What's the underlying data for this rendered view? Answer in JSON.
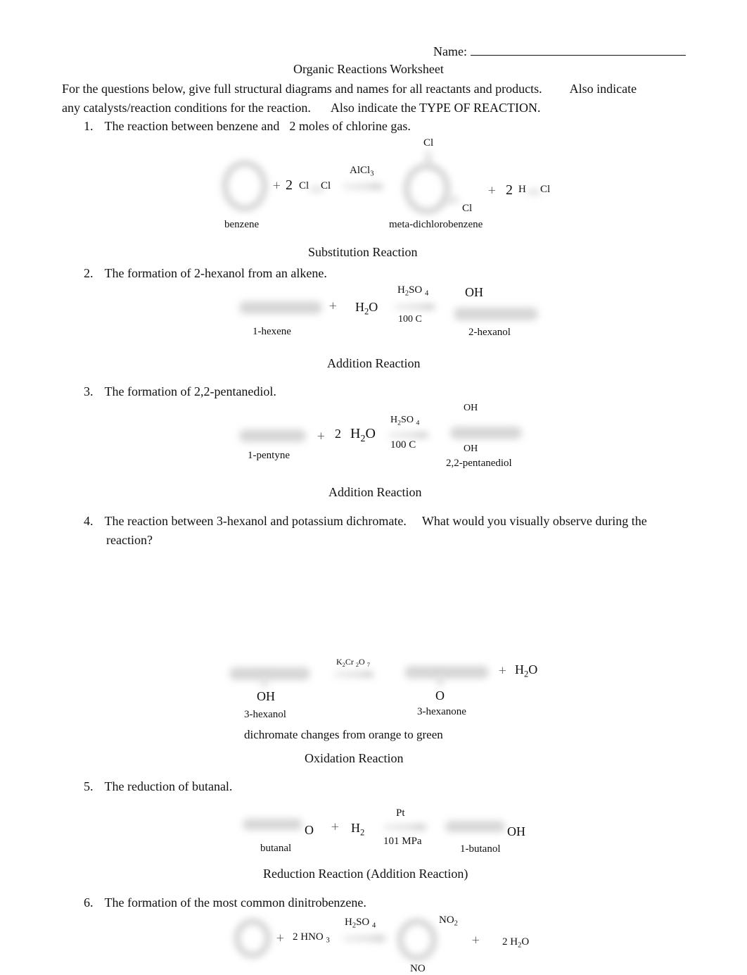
{
  "header": {
    "name_label": "Name:",
    "title": "Organic Reactions Worksheet"
  },
  "instructions": {
    "line1a": "For the questions below, give full structural diagrams and names for all reactants and products.",
    "line1b": "Also indicate",
    "line2a": "any catalysts/reaction conditions for the reaction.",
    "line2b": "Also indicate the TYPE OF REACTION."
  },
  "questions": [
    {
      "number": "1.",
      "text_a": "The reaction between benzene and",
      "text_b": "2 moles",
      "text_c": "of chlorine gas.",
      "reactant1_name": "benzene",
      "coef1": "2",
      "cl_a": "Cl",
      "cl_b": "Cl",
      "catalyst": "AlCl",
      "catalyst_sub": "3",
      "product_cl_top": "Cl",
      "product_cl_bottom": "Cl",
      "product_name": "meta-dichlorobenzene",
      "coef2": "2",
      "h": "H",
      "hcl_cl": "Cl",
      "plus": "+",
      "reaction_type": "Substitution Reaction"
    },
    {
      "number": "2.",
      "text": "The formation of 2-hexanol from an alkene.",
      "reactant_name": "1-hexene",
      "water_h": "H",
      "water_sub": "2",
      "water_o": "O",
      "catalyst_h": "H",
      "catalyst_sub1": "2",
      "catalyst_so": "SO",
      "catalyst_sub2": "4",
      "condition": "100 C",
      "product_oh": "OH",
      "product_name": "2-hexanol",
      "plus": "+",
      "reaction_type": "Addition Reaction"
    },
    {
      "number": "3.",
      "text": "The formation of 2,2-pentanediol.",
      "reactant_name": "1-pentyne",
      "coef": "2",
      "water_h": "H",
      "water_sub": "2",
      "water_o": "O",
      "catalyst_h": "H",
      "catalyst_sub1": "2",
      "catalyst_so": "SO",
      "catalyst_sub2": "4",
      "condition": "100 C",
      "product_oh_top": "OH",
      "product_oh_bottom": "OH",
      "product_name": "2,2-pentanediol",
      "plus": "+",
      "reaction_type": "Addition Reaction"
    },
    {
      "number": "4.",
      "text_line1": "The reaction between 3-hexanol and potassium dichromate.",
      "text_line1b": "What would you visually observe during the",
      "text_line2": "reaction?",
      "reactant_oh": "OH",
      "reactant_name": "3-hexanol",
      "catalyst_k": "K",
      "catalyst_sub1": "2",
      "catalyst_cr": "Cr",
      "catalyst_sub2": "2",
      "catalyst_o": "O",
      "catalyst_sub3": "7",
      "product_o": "O",
      "product_name": "3-hexanone",
      "water_h": "H",
      "water_sub": "2",
      "water_o": "O",
      "observation": "dichromate changes from orange to green",
      "plus": "+",
      "reaction_type": "Oxidation Reaction"
    },
    {
      "number": "5.",
      "text": "The reduction of butanal.",
      "reactant_o": "O",
      "reactant_name": "butanal",
      "h2_h": "H",
      "h2_sub": "2",
      "catalyst": "Pt",
      "condition": "101 MPa",
      "product_oh": "OH",
      "product_name": "1-butanol",
      "plus": "+",
      "reaction_type": "Reduction Reaction (Addition Reaction)"
    },
    {
      "number": "6.",
      "text": "The formation of the most common dinitrobenzene.",
      "reagent": "2 HNO",
      "reagent_sub": "3",
      "catalyst_h": "H",
      "catalyst_sub1": "2",
      "catalyst_so": "SO",
      "catalyst_sub2": "4",
      "product_no2_top": "NO",
      "product_no2_top_sub": "2",
      "product_no2_bottom": "NO",
      "water_coef": "2 H",
      "water_sub": "2",
      "water_o": "O",
      "plus": "+"
    }
  ]
}
